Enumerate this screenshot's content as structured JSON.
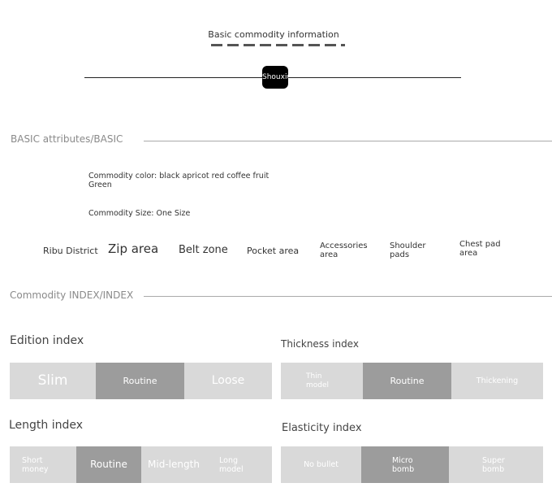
{
  "header": {
    "title": "Basic commodity information",
    "brand": "Shouxiu"
  },
  "basic_section": {
    "label": "BASIC attributes/BASIC",
    "color_line1": "Commodity color: black apricot red coffee fruit",
    "color_line2": "Green",
    "size_line": "Commodity Size: One Size"
  },
  "zones": {
    "ribu": "Ribu District",
    "zip": "Zip area",
    "belt": "Belt zone",
    "pocket": "Pocket area",
    "accessories_1": "Accessories",
    "accessories_2": "area",
    "shoulder_1": "Shoulder",
    "shoulder_2": "pads",
    "chest_1": "Chest pad",
    "chest_2": "area"
  },
  "index_section": {
    "label": "Commodity INDEX/INDEX"
  },
  "edition_index": {
    "title": "Edition index",
    "selected": "Routine",
    "options": [
      "Slim",
      "Routine",
      "Loose"
    ]
  },
  "thickness_index": {
    "title": "Thickness index",
    "selected": "Routine",
    "thin_1": "Thin",
    "thin_2": "model",
    "routine": "Routine",
    "thickening": "Thickening"
  },
  "length_index": {
    "title": "Length index",
    "selected": "Routine",
    "short_1": "Short",
    "short_2": "money",
    "routine": "Routine",
    "mid": "Mid-length",
    "long_1": "Long",
    "long_2": "model"
  },
  "elasticity_index": {
    "title": "Elasticity index",
    "selected": "Micro bomb",
    "no_bullet": "No bullet",
    "micro_1": "Micro",
    "micro_2": "bomb",
    "super_1": "Super",
    "super_2": "bomb"
  },
  "colors": {
    "segment": "#d9d9d9",
    "segment_active": "#9c9c9c",
    "rule": "#aaaaaa"
  }
}
